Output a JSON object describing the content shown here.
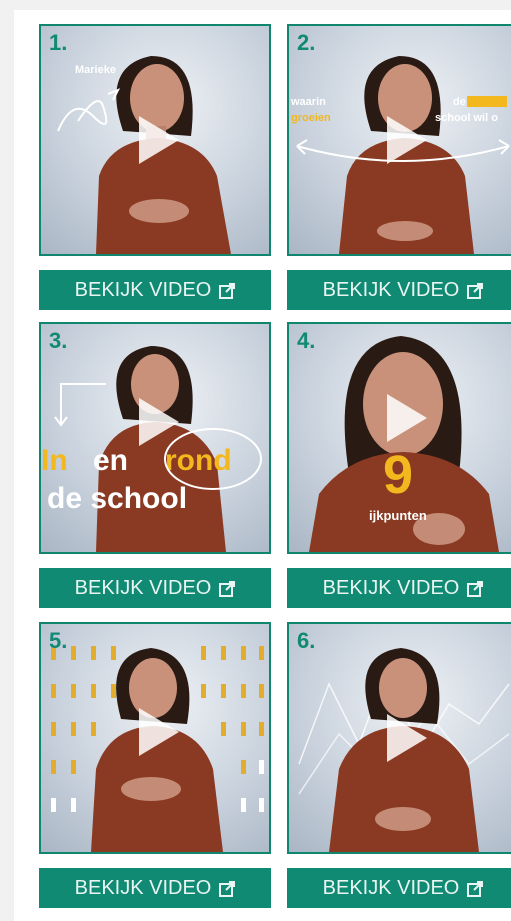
{
  "videos": [
    {
      "number": "1.",
      "button": "BEKIJK VIDEO",
      "overlay": [
        "Marieke"
      ]
    },
    {
      "number": "2.",
      "button": "BEKIJK VIDEO",
      "overlay": [
        "waarin",
        "groeien",
        "de",
        "school wil o"
      ]
    },
    {
      "number": "3.",
      "button": "BEKIJK VIDEO",
      "overlay": [
        "In",
        "en",
        "rond",
        "de school"
      ]
    },
    {
      "number": "4.",
      "button": "BEKIJK VIDEO",
      "overlay": [
        "9",
        "ijkpunten"
      ]
    },
    {
      "number": "5.",
      "button": "BEKIJK VIDEO",
      "overlay": []
    },
    {
      "number": "6.",
      "button": "BEKIJK VIDEO",
      "overlay": []
    }
  ],
  "colors": {
    "accent": "#118a73",
    "yellow": "#f2b81e"
  },
  "icons": {
    "play": "play-icon",
    "external": "external-link-icon"
  }
}
